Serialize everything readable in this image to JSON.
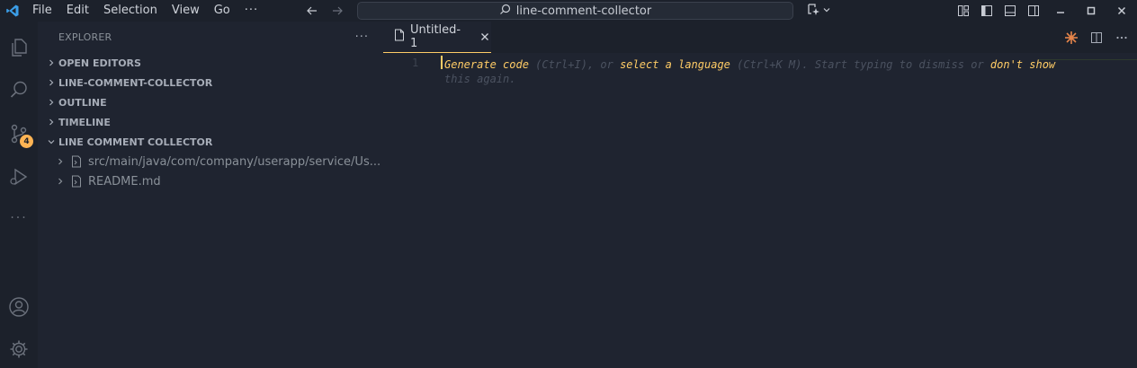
{
  "titlebar": {
    "menu": [
      "File",
      "Edit",
      "Selection",
      "View",
      "Go"
    ],
    "more": "···",
    "command_center": "line-comment-collector"
  },
  "activity": {
    "scm_badge": "4",
    "more": "···"
  },
  "sidebar": {
    "title": "EXPLORER",
    "more": "···",
    "sections": {
      "open_editors": "OPEN EDITORS",
      "project": "LINE-COMMENT-COLLECTOR",
      "outline": "OUTLINE",
      "timeline": "TIMELINE",
      "collector": "LINE COMMENT COLLECTOR"
    },
    "files": [
      "src/main/java/com/company/userapp/service/Us...",
      "README.md"
    ]
  },
  "editor": {
    "tab_label": "Untitled-1",
    "line_number": "1",
    "hint": {
      "generate": "Generate code",
      "generate_key": " (Ctrl+I), or ",
      "select_lang": "select a language",
      "select_key": " (Ctrl+K M). Start typing to dismiss or ",
      "dont_show": "don't show",
      "tail": "this again."
    }
  },
  "colors": {
    "accent": "#ffcc66",
    "badge": "#ffb454",
    "background": "#1f2430",
    "bar": "#1c212b"
  },
  "icons": [
    "vscode-logo-icon",
    "files-icon",
    "search-icon",
    "source-control-icon",
    "run-debug-icon",
    "account-icon",
    "settings-gear-icon"
  ]
}
